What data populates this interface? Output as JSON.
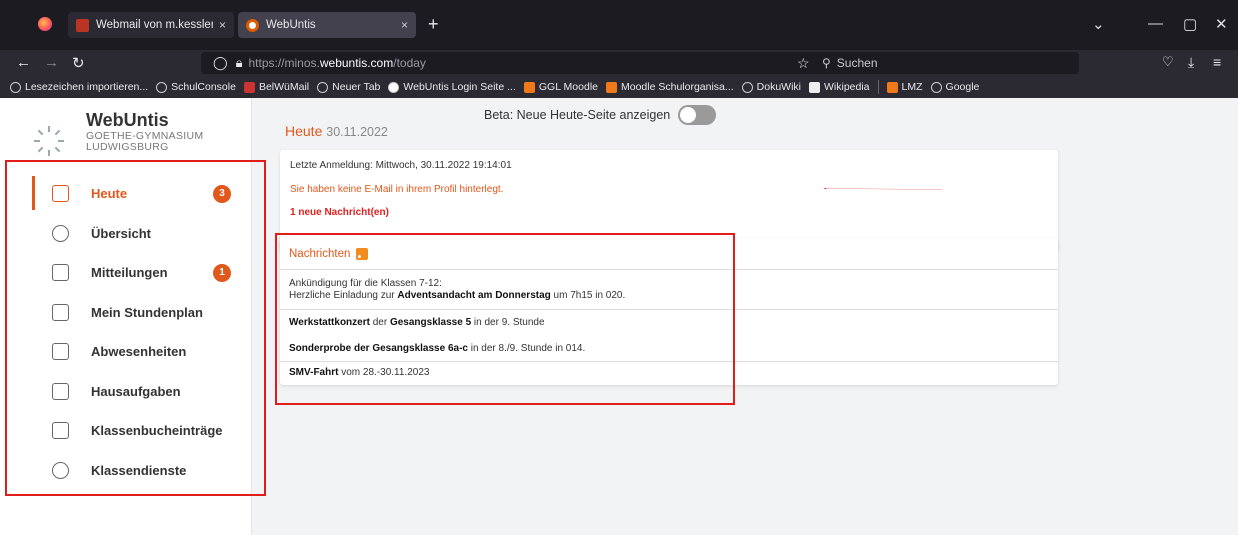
{
  "browser": {
    "tabs": [
      {
        "label": "Webmail von m.kessler@goeth",
        "close": "×"
      },
      {
        "label": "WebUntis",
        "close": "×"
      }
    ],
    "new_tab": "+",
    "url_prefix": "https://minos.",
    "url_domain": "webuntis.com",
    "url_path": "/today",
    "search_placeholder": "Suchen",
    "bookmarks": [
      "Lesezeichen importieren...",
      "SchulConsole",
      "BelWüMail",
      "Neuer Tab",
      "WebUntis Login Seite ...",
      "GGL Moodle",
      "Moodle Schulorganisa...",
      "DokuWiki",
      "Wikipedia",
      "LMZ",
      "Google"
    ]
  },
  "app": {
    "logo_title": "WebUntis",
    "school_line1": "GOETHE-GYMNASIUM",
    "school_line2": "LUDWIGSBURG",
    "nav": [
      {
        "label": "Heute",
        "badge": "3",
        "icon": "dashboard-icon",
        "active": true
      },
      {
        "label": "Übersicht",
        "badge": "",
        "icon": "overview-icon"
      },
      {
        "label": "Mitteilungen",
        "badge": "1",
        "icon": "mail-icon"
      },
      {
        "label": "Mein Stundenplan",
        "badge": "",
        "icon": "calendar-icon"
      },
      {
        "label": "Abwesenheiten",
        "badge": "",
        "icon": "absence-icon"
      },
      {
        "label": "Hausaufgaben",
        "badge": "",
        "icon": "homework-icon"
      },
      {
        "label": "Klassenbucheinträge",
        "badge": "",
        "icon": "classbook-icon"
      },
      {
        "label": "Klassendienste",
        "badge": "",
        "icon": "class-duties-icon"
      }
    ],
    "beta_label": "Beta: Neue Heute-Seite anzeigen",
    "heading": "Heute",
    "heading_date": "30.11.2022",
    "info": {
      "last_login": "Letzte Anmeldung: Mittwoch, 30.11.2022 19:14:01",
      "no_email": "Sie haben keine E-Mail in ihrem Profil hinterlegt.",
      "new_messages": "1 neue Nachricht(en)"
    },
    "news": {
      "title": "Nachrichten",
      "m1_line1": "Ankündigung für die Klassen 7-12:",
      "m1_pre": "Herzliche Einladung zur ",
      "m1_bold": "Adventsandacht am Donnerstag",
      "m1_post": " um 7h15 in 020.",
      "m2_bold1": "Werkstattkonzert",
      "m2_mid1": " der ",
      "m2_bold2": "Gesangsklasse 5",
      "m2_post1": " in der 9. Stunde",
      "m2_bold3": "Sonderprobe der Gesangsklasse 6a-c",
      "m2_post2": " in der 8./9. Stunde in 014.",
      "m3_bold": "SMV-Fahrt",
      "m3_post": " vom 28.-30.11.2023"
    }
  },
  "colors": {
    "accent": "#e0581c",
    "annotation": "#e21b1b"
  }
}
